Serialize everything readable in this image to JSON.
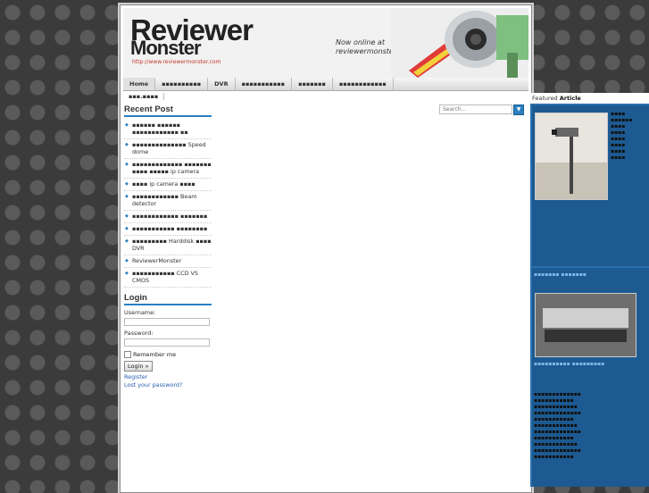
{
  "header": {
    "logo_line1": "Reviewer",
    "logo_line2": "Monster",
    "logo_url": "http://www.reviewermonster.com",
    "tagline_1": "Now online at",
    "tagline_2": "reviewermonster.com"
  },
  "nav": {
    "items": [
      "Home",
      "▪▪▪▪▪▪▪▪▪▪",
      "DVR",
      "▪▪▪▪▪▪▪▪▪▪▪",
      "▪▪▪▪▪▪▪",
      "▪▪▪▪▪▪▪▪▪▪▪▪"
    ],
    "subitems": [
      "▪▪▪.▪▪▪▪"
    ]
  },
  "search": {
    "placeholder": "Search..."
  },
  "sidebar": {
    "recent_title": "Recent Post",
    "posts": [
      "▪▪▪▪▪▪ ▪▪▪▪▪▪ ▪▪▪▪▪▪▪▪▪▪▪▪ ▪▪",
      "▪▪▪▪▪▪▪▪▪▪▪▪▪▪ Speed dome",
      "▪▪▪▪▪▪▪▪▪▪▪▪▪ ▪▪▪▪▪▪▪ ▪▪▪▪ ▪▪▪▪▪ ip camera",
      "▪▪▪▪ ip camera ▪▪▪▪",
      "▪▪▪▪▪▪▪▪▪▪▪▪ Beam detector",
      "▪▪▪▪▪▪▪▪▪▪▪▪ ▪▪▪▪▪▪▪",
      "▪▪▪▪▪▪▪▪▪▪▪ ▪▪▪▪▪▪▪▪",
      "▪▪▪▪▪▪▪▪▪ Harddisk ▪▪▪▪ DVR",
      "ReviewerMonster",
      "▪▪▪▪▪▪▪▪▪▪▪ CCD VS CMOS"
    ],
    "login_title": "Login",
    "username_label": "Username:",
    "password_label": "Password:",
    "remember_label": "Remember me",
    "login_button": "Login »",
    "register_link": "Register",
    "lost_password_link": "Lost your password?"
  },
  "featured": {
    "title_prefix": "Featured ",
    "title_bold": "Article",
    "panel1_text": "▪▪▪▪\n▪▪▪▪▪▪\n▪▪▪▪\n▪▪▪▪\n▪▪▪▪\n▪▪▪▪\n▪▪▪▪\n▪▪▪▪",
    "panel2_heading": "▪▪▪▪▪▪▪ ▪▪▪▪▪▪▪",
    "panel2_caption": "▪▪▪▪▪▪▪▪▪▪ ▪▪▪▪▪▪▪▪▪",
    "panel2_body": "▪▪▪▪▪▪▪▪▪▪▪▪▪\n▪▪▪▪▪▪▪▪▪▪▪\n▪▪▪▪▪▪▪▪▪▪▪▪\n▪▪▪▪▪▪▪▪▪▪▪▪▪\n▪▪▪▪▪▪▪▪▪▪▪\n▪▪▪▪▪▪▪▪▪▪▪▪\n▪▪▪▪▪▪▪▪▪▪▪▪▪\n▪▪▪▪▪▪▪▪▪▪▪\n▪▪▪▪▪▪▪▪▪▪▪▪\n▪▪▪▪▪▪▪▪▪▪▪▪▪\n▪▪▪▪▪▪▪▪▪▪▪"
  },
  "colors": {
    "accent": "#2a7fc1",
    "featured_bg": "#2a6fae"
  }
}
